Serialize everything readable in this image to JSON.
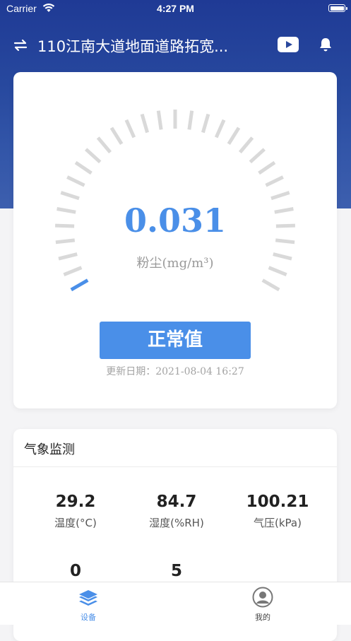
{
  "status_bar": {
    "carrier": "Carrier",
    "time": "4:27 PM"
  },
  "header": {
    "title": "110江南大道地面道路拓宽...",
    "left_icon": "swap-icon",
    "play_icon": "play-icon",
    "bell_icon": "bell-icon"
  },
  "gauge": {
    "value": "0.031",
    "unit": "粉尘(mg/m³)",
    "level_fraction": 0.03,
    "status_label": "正常值",
    "updated_text": "更新日期：2021-08-04 16:27",
    "colors": {
      "active": "#4a8fe8",
      "inactive": "#d9d9d9"
    }
  },
  "weather": {
    "title": "气象监测",
    "metrics": [
      {
        "value": "29.2",
        "label": "温度(°C)"
      },
      {
        "value": "84.7",
        "label": "湿度(%RH)"
      },
      {
        "value": "100.21",
        "label": "气压(kPa)"
      },
      {
        "value": "0",
        "label": ""
      },
      {
        "value": "5",
        "label": ""
      }
    ]
  },
  "tabs": [
    {
      "label": "设备",
      "icon": "layers-icon",
      "active": true
    },
    {
      "label": "我的",
      "icon": "user-circle-icon",
      "active": false
    }
  ],
  "colors": {
    "accent": "#4a8fe8",
    "header_bg": "#2a489d"
  }
}
